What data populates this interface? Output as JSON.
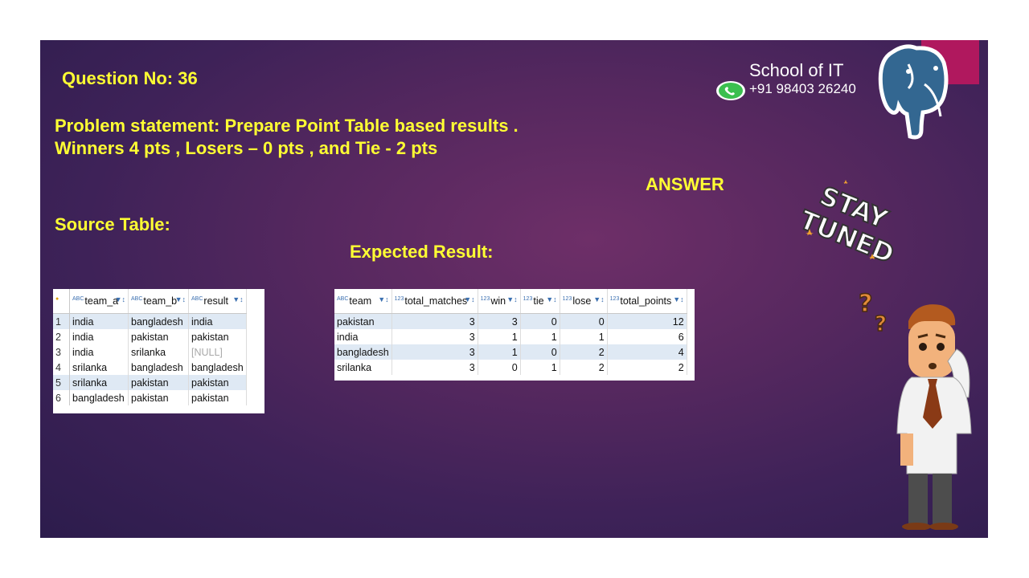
{
  "question": "Question No: 36",
  "problem_line1": "Problem statement: Prepare Point Table based results .",
  "problem_line2": "Winners 4 pts , Losers – 0 pts , and Tie -  2 pts",
  "answer_label": "ANSWER",
  "source_label": "Source Table:",
  "expected_label": "Expected Result:",
  "brand": {
    "school": "School of IT",
    "phone": "+91 98403 26240"
  },
  "sticker_text": "STAY TUNED",
  "source_table": {
    "columns": [
      "team_a",
      "team_b",
      "result"
    ],
    "rows": [
      [
        "1",
        "india",
        "bangladesh",
        "india"
      ],
      [
        "2",
        "india",
        "pakistan",
        "pakistan"
      ],
      [
        "3",
        "india",
        "srilanka",
        "[NULL]"
      ],
      [
        "4",
        "srilanka",
        "bangladesh",
        "bangladesh"
      ],
      [
        "5",
        "srilanka",
        "pakistan",
        "pakistan"
      ],
      [
        "6",
        "bangladesh",
        "pakistan",
        "pakistan"
      ]
    ]
  },
  "expected_table": {
    "columns": [
      "team",
      "total_matches",
      "win",
      "tie",
      "lose",
      "total_points"
    ],
    "rows": [
      [
        "pakistan",
        "3",
        "3",
        "0",
        "0",
        "12"
      ],
      [
        "india",
        "3",
        "1",
        "1",
        "1",
        "6"
      ],
      [
        "bangladesh",
        "3",
        "1",
        "0",
        "2",
        "4"
      ],
      [
        "srilanka",
        "3",
        "0",
        "1",
        "2",
        "2"
      ]
    ]
  },
  "colors": {
    "heading": "#ffff33",
    "accent": "#b0185e",
    "row_alt": "#dfe9f4"
  }
}
